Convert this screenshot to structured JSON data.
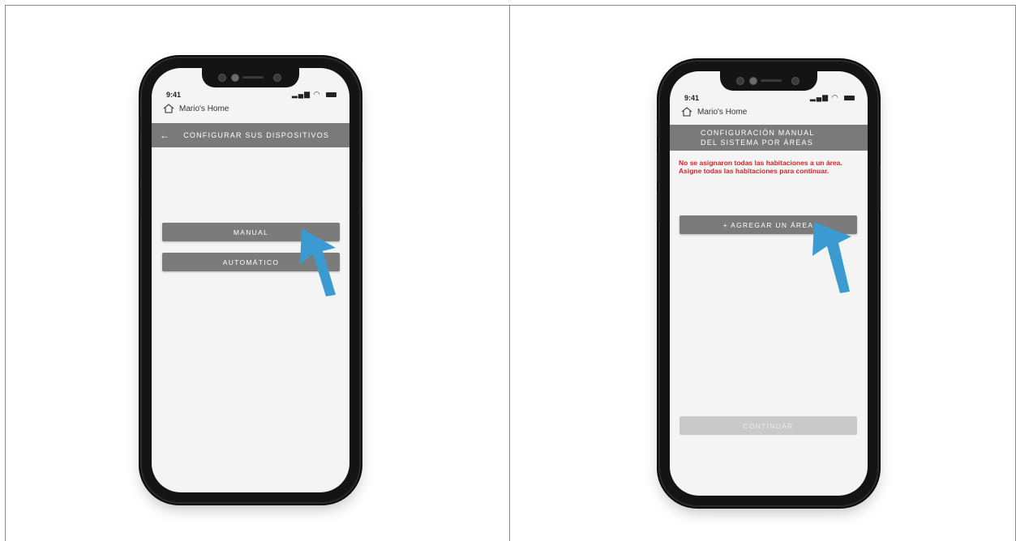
{
  "left_screen": {
    "status_time": "9:41",
    "home_label": "Mario's Home",
    "header_title": "CONFIGURAR SUS DISPOSITIVOS",
    "buttons": {
      "manual": "MANUAL",
      "automatic": "AUTOMÁTICO"
    }
  },
  "right_screen": {
    "status_time": "9:41",
    "home_label": "Mario's Home",
    "header_title_line1": "CONFIGURACIÓN MANUAL",
    "header_title_line2": "DEL SISTEMA POR ÁREAS",
    "error_message": "No se asignaron todas las habitaciones a un área. Asigne todas las habitaciones para continuar.",
    "buttons": {
      "add_area": "+ AGREGAR UN ÁREA",
      "continue": "CONTINUAR"
    }
  },
  "colors": {
    "header_bg": "#7a7a7a",
    "button_bg": "#7b7b7b",
    "error_red": "#d0272b",
    "pointer_blue": "#3b9bd1",
    "disabled_bg": "#c9c9c9"
  },
  "icons": {
    "status": [
      "signal-icon",
      "wifi-icon",
      "battery-icon"
    ],
    "home": "home-icon",
    "back": "back-arrow-icon",
    "pointer": "cursor-arrow-icon"
  }
}
